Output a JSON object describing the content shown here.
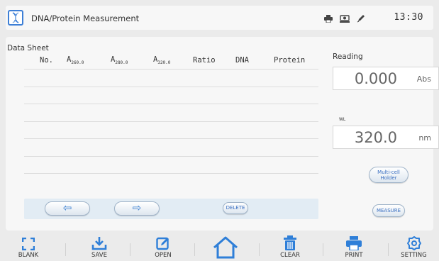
{
  "app": {
    "title": "DNA/Protein Measurement",
    "clock": "13:30"
  },
  "data_sheet": {
    "label": "Data Sheet",
    "columns": [
      {
        "text": "No.",
        "sub": ""
      },
      {
        "text": "A",
        "sub": "260.0"
      },
      {
        "text": "A",
        "sub": "280.0"
      },
      {
        "text": "A",
        "sub": "320.0"
      },
      {
        "text": "Ratio",
        "sub": ""
      },
      {
        "text": "DNA",
        "sub": ""
      },
      {
        "text": "Protein",
        "sub": ""
      }
    ],
    "delete_label": "DELETE"
  },
  "reading": {
    "label": "Reading",
    "value": "0.000",
    "unit": "Abs"
  },
  "wavelength": {
    "label": "WL",
    "value": "320.0",
    "unit": "nm"
  },
  "buttons": {
    "multi_cell_line1": "Multi-cell",
    "multi_cell_line2": "Holder",
    "measure": "MEASURE"
  },
  "toolbar": {
    "blank": "BLANK",
    "save": "SAVE",
    "open": "OPEN",
    "home": "",
    "clear": "CLEAR",
    "print": "PRINT",
    "setting": "SETTING"
  },
  "colors": {
    "accent": "#2f7fd8",
    "panel": "#f7f7f7",
    "background": "#ebebeb"
  }
}
